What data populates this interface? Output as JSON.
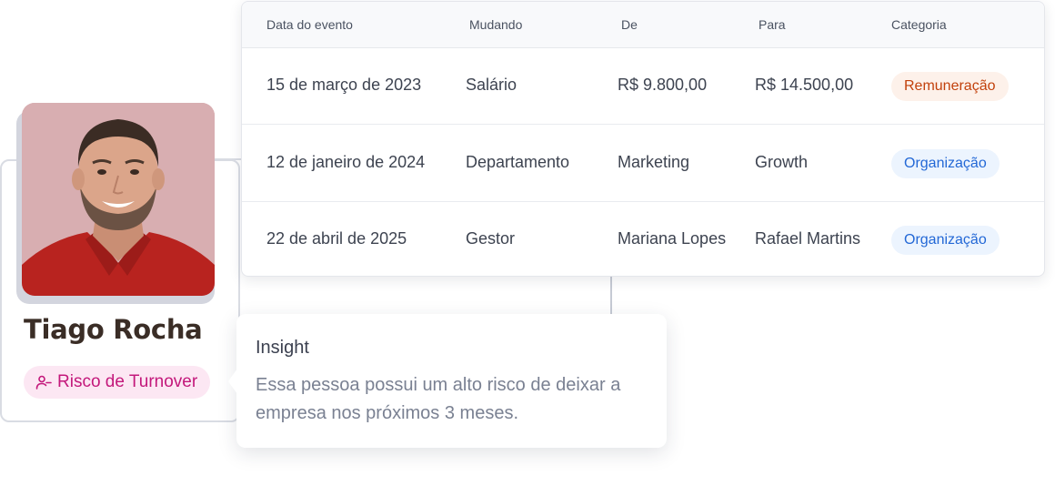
{
  "profile": {
    "name": "Tiago Rocha",
    "risk_label": "Risco de Turnover",
    "risk_icon": "user-minus-icon",
    "colors": {
      "badge_bg": "#fce7f3",
      "badge_text": "#c3187b",
      "photo_bg": "#d8aeb1"
    }
  },
  "history_table": {
    "headers": {
      "date": "Data do evento",
      "changing": "Mudando",
      "from": "De",
      "to": "Para",
      "category": "Categoria"
    },
    "rows": [
      {
        "date": "15 de março de 2023",
        "changing": "Salário",
        "from": "R$ 9.800,00",
        "to": "R$ 14.500,00",
        "category": "Remuneração",
        "category_color": "#c2410c"
      },
      {
        "date": "12 de janeiro de 2024",
        "changing": "Departamento",
        "from": "Marketing",
        "to": "Growth",
        "category": "Organização",
        "category_color": "#2368d6"
      },
      {
        "date": "22 de abril de 2025",
        "changing": "Gestor",
        "from": "Mariana Lopes",
        "to": "Rafael Martins",
        "category": "Organização",
        "category_color": "#2368d6"
      }
    ]
  },
  "insight": {
    "title": "Insight",
    "text": "Essa pessoa possui um alto risco de deixar a empresa nos próximos 3 meses."
  }
}
